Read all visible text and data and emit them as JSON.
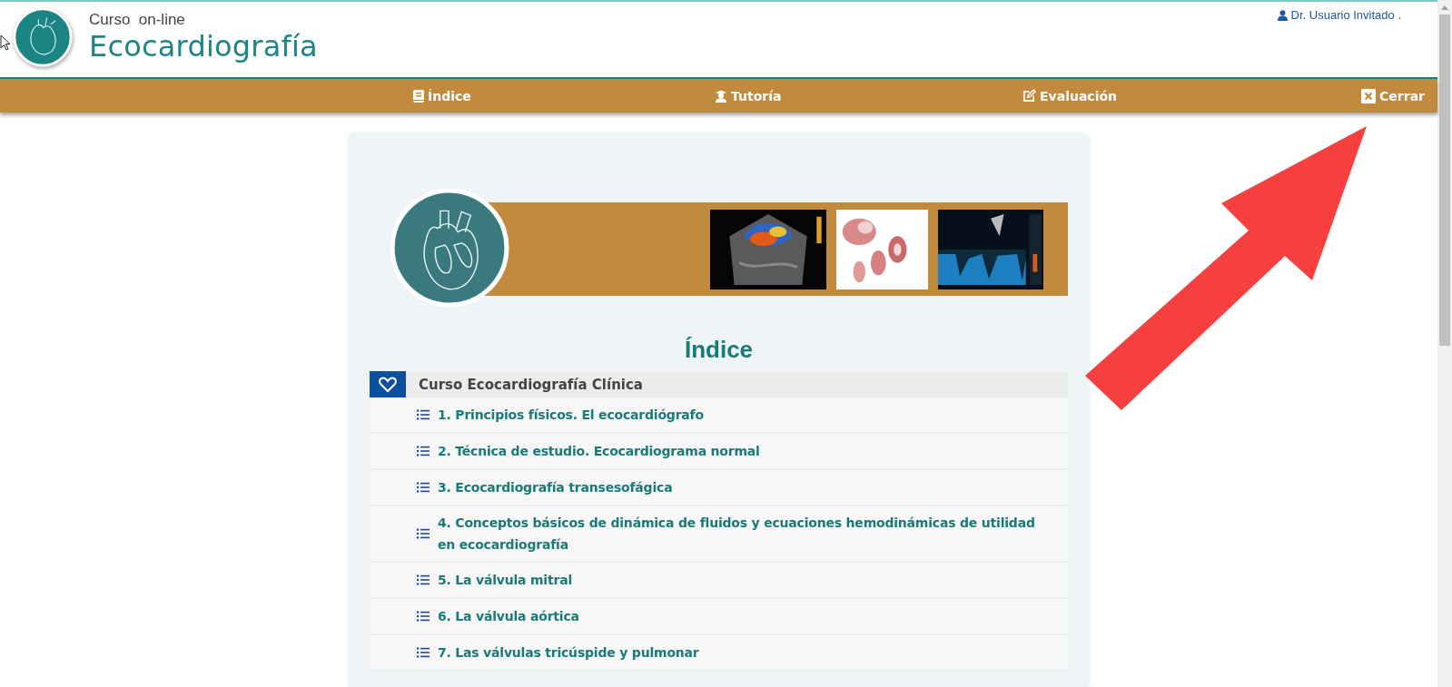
{
  "header": {
    "subtitle": "Curso  on-line",
    "title": "Ecocardiografía",
    "user": "Dr. Usuario Invitado ."
  },
  "nav": [
    {
      "label": "Índice",
      "kind": "book"
    },
    {
      "label": "Tutoría",
      "kind": "tutor"
    },
    {
      "label": "Evaluación",
      "kind": "edit"
    },
    {
      "label": "Cerrar",
      "kind": "close"
    }
  ],
  "index": {
    "title": "Índice",
    "course": "Curso Ecocardiografía Clínica",
    "chapters": [
      "1. Principios físicos. El ecocardiógrafo",
      "2. Técnica de estudio. Ecocardiograma normal",
      "3. Ecocardiografía transesofágica",
      "4. Conceptos básicos de dinámica de fluidos y ecuaciones hemodinámicas de utilidad en ecocardiografía",
      "5. La válvula mitral",
      "6. La válvula aórtica",
      "7. Las válvulas tricúspide y pulmonar"
    ]
  }
}
